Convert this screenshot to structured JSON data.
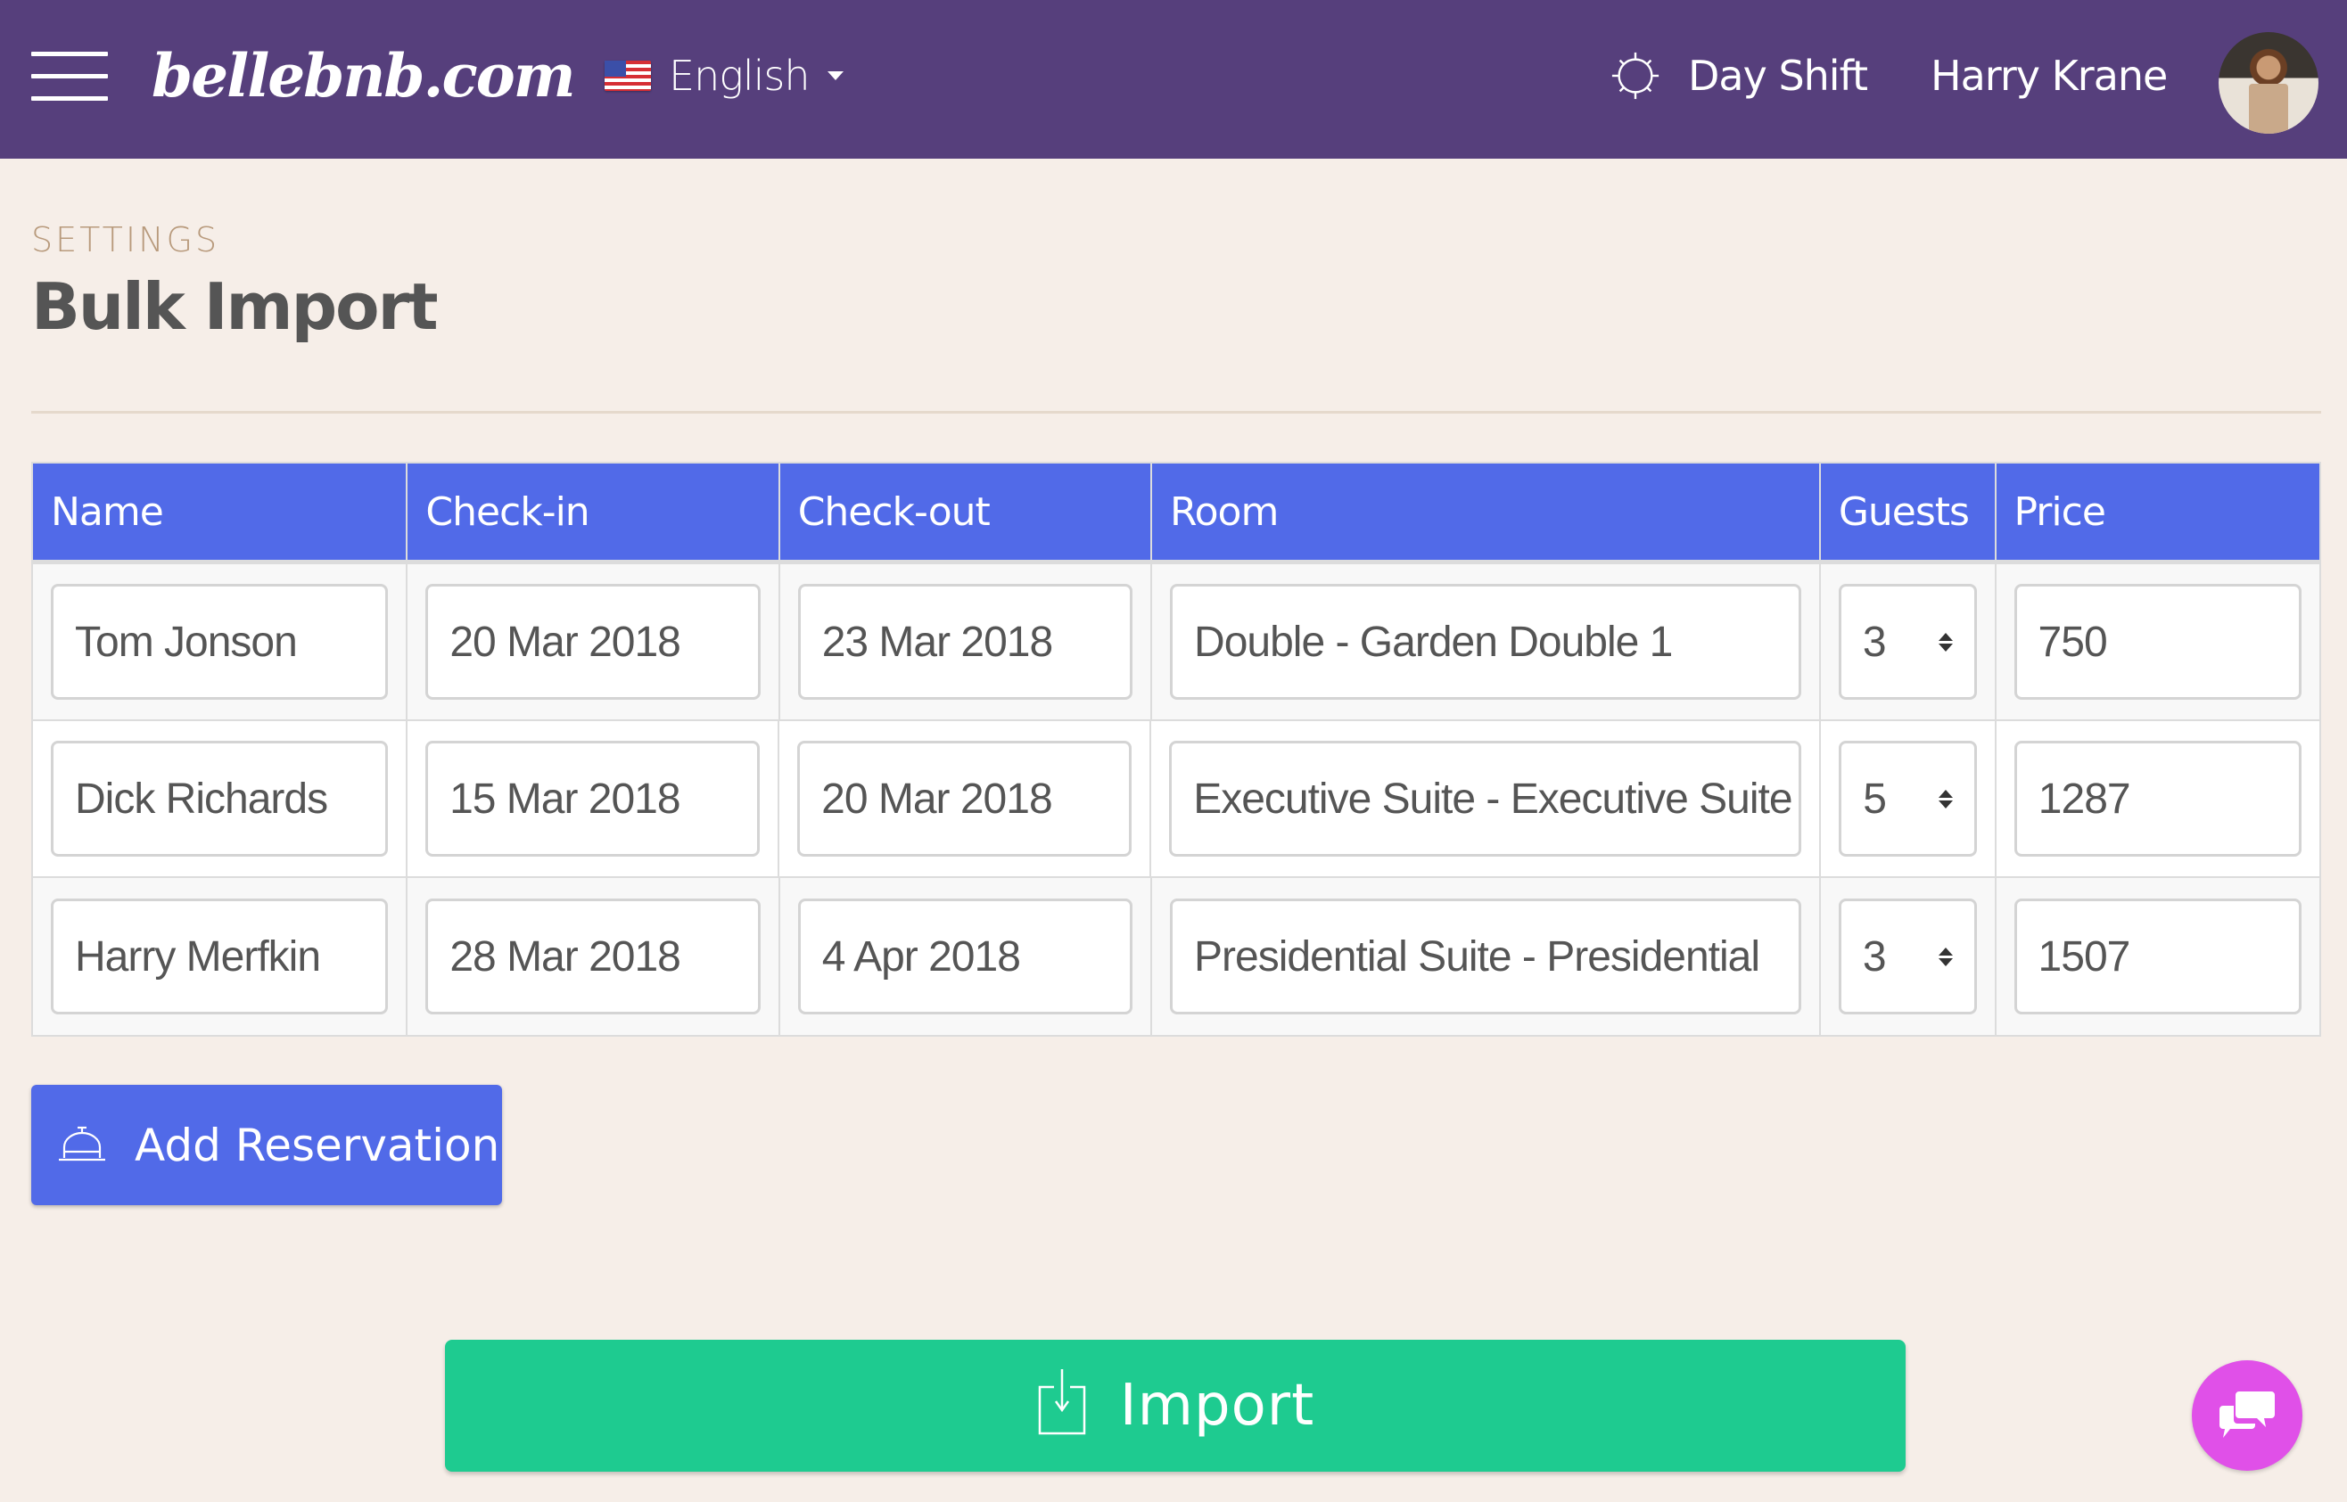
{
  "header": {
    "menu_icon": "hamburger-icon",
    "logo": "bellebnb.com",
    "language": {
      "flag": "us-flag-icon",
      "label": "English",
      "caret": "caret-down-icon"
    },
    "shift": {
      "icon": "sun-icon",
      "label": "Day Shift"
    },
    "user": {
      "name": "Harry Krane",
      "avatar": "user-avatar"
    }
  },
  "page": {
    "eyebrow": "SETTINGS",
    "title": "Bulk Import"
  },
  "table": {
    "columns": [
      "Name",
      "Check-in",
      "Check-out",
      "Room",
      "Guests",
      "Price"
    ],
    "rows": [
      {
        "name": "Tom Jonson",
        "checkin": "20 Mar 2018",
        "checkout": "23 Mar 2018",
        "room": "Double - Garden Double 1",
        "guests": "3",
        "price": "750"
      },
      {
        "name": "Dick Richards",
        "checkin": "15 Mar 2018",
        "checkout": "20 Mar 2018",
        "room": "Executive Suite - Executive Suite",
        "guests": "5",
        "price": "1287"
      },
      {
        "name": "Harry Merfkin",
        "checkin": "28 Mar 2018",
        "checkout": "4 Apr 2018",
        "room": "Presidential Suite - Presidential",
        "guests": "3",
        "price": "1507"
      }
    ]
  },
  "actions": {
    "add_reservation": {
      "icon": "service-bell-icon",
      "label": "Add Reservation"
    },
    "import": {
      "icon": "import-icon",
      "label": "Import"
    },
    "chat": {
      "icon": "chat-bubbles-icon"
    }
  },
  "colors": {
    "topbar": "#563f7c",
    "background": "#f6eee8",
    "primary": "#516ae8",
    "import": "#1ecb90",
    "chat": "#e050e8",
    "eyebrow": "#b89a7c"
  }
}
